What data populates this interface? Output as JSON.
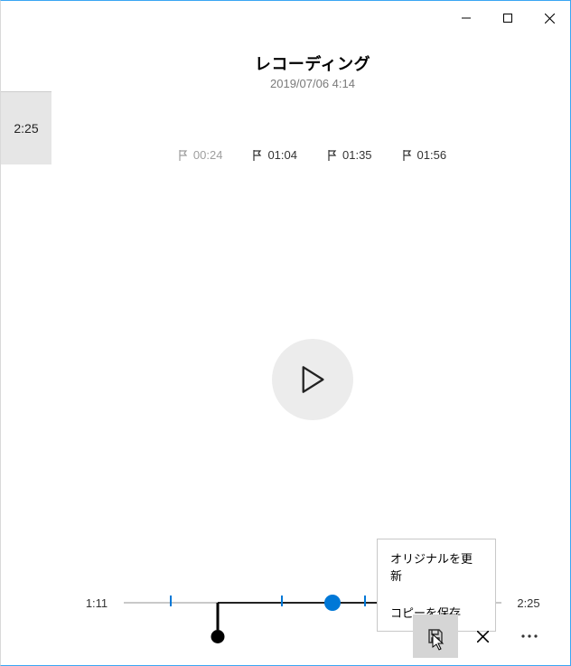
{
  "window": {
    "controls": {
      "min": "minimize",
      "max": "maximize",
      "close": "close"
    }
  },
  "sidebar": {
    "thumb_duration": "2:25"
  },
  "header": {
    "title": "レコーディング",
    "date": "2019/07/06 4:14"
  },
  "markers": [
    {
      "label": "00:24",
      "active": true
    },
    {
      "label": "01:04",
      "active": false
    },
    {
      "label": "01:35",
      "active": false
    },
    {
      "label": "01:56",
      "active": false
    }
  ],
  "playback": {
    "state": "paused"
  },
  "timeline": {
    "start_label": "1:11",
    "end_label": "2:25",
    "length_seconds": 145,
    "playhead_seconds": 83,
    "trim_start_seconds": 41,
    "trim_end_seconds": 116,
    "tick_marks_seconds": [
      24,
      64,
      95,
      116
    ]
  },
  "popup": {
    "items": [
      {
        "label": "オリジナルを更新"
      },
      {
        "label": "コピーを保存"
      }
    ]
  },
  "bottombar": {
    "save": "save",
    "cancel": "cancel",
    "more": "more"
  }
}
